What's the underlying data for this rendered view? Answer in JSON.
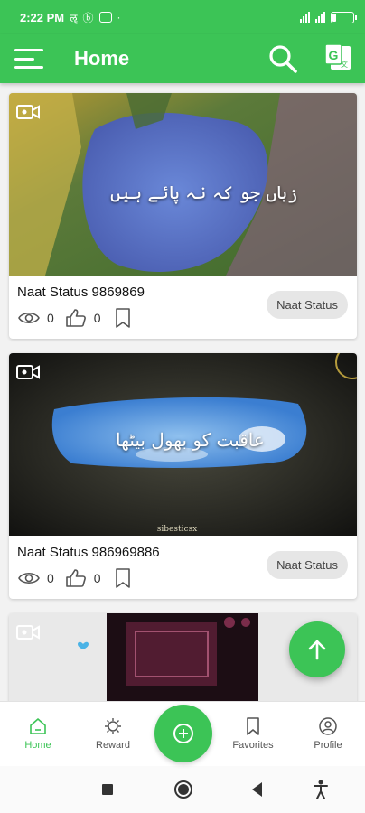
{
  "status_bar": {
    "time": "2:22 PM",
    "battery_label": "16",
    "battery_level": 0.16
  },
  "app_bar": {
    "title": "Home",
    "menu_icon": "hamburger-menu-icon",
    "search_icon": "search-icon",
    "translate_icon": "translate-icon"
  },
  "feed": [
    {
      "title": "Naat Status 9869869",
      "overlay_text": "زباں جو کہ نہ پائے ہیں",
      "views": "0",
      "likes": "0",
      "tag": "Naat Status"
    },
    {
      "title": "Naat Status 986969886",
      "overlay_text": "عاقبت کو بھول بیٹھا",
      "watermark": "sibesticsx",
      "views": "0",
      "likes": "0",
      "tag": "Naat Status"
    }
  ],
  "bottom_nav": {
    "items": [
      {
        "label": "Home",
        "icon": "home-icon"
      },
      {
        "label": "Reward",
        "icon": "reward-icon"
      },
      {
        "label": "Favorites",
        "icon": "bookmark-icon"
      },
      {
        "label": "Profile",
        "icon": "profile-icon"
      }
    ]
  },
  "colors": {
    "brand": "#3cc456",
    "background": "#f2f2f2"
  }
}
